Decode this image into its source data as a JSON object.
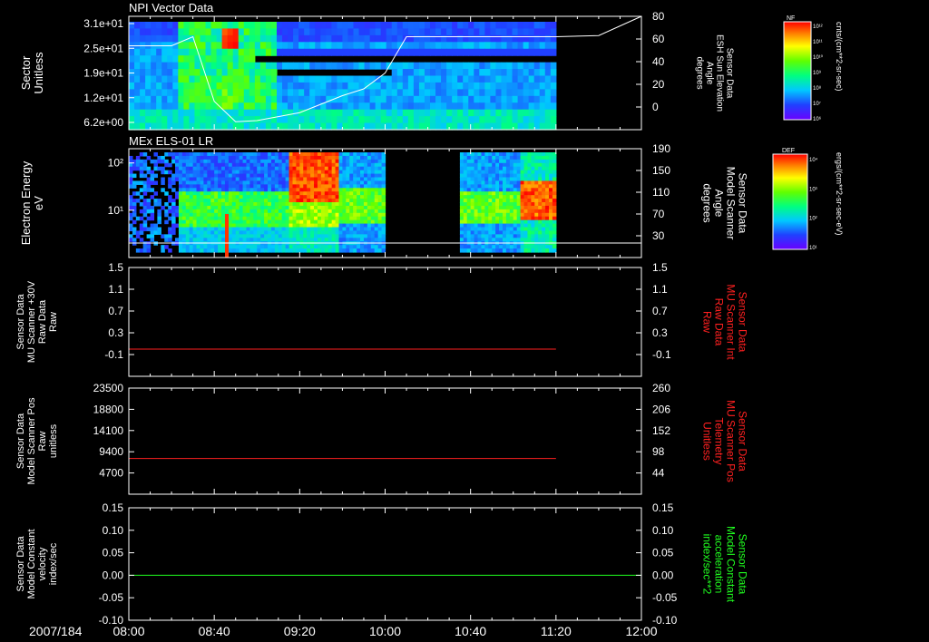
{
  "chart_data": [
    {
      "type": "heatmap",
      "title": "NPI Vector Data",
      "ylabel_left": [
        "Sector",
        "Unitless"
      ],
      "yticks_left": [
        "3.1e+01",
        "2.5e+01",
        "1.9e+01",
        "1.2e+01",
        "6.2e+00"
      ],
      "ylabel_right": [
        "Sensor Data",
        "ESH Sun Elevation",
        "Angle",
        "degrees"
      ],
      "yticks_right": [
        "80",
        "60",
        "40",
        "20",
        "0"
      ],
      "ylim_right": [
        -20,
        80
      ],
      "colorbar": {
        "label": "NF",
        "units": "cnts/(cm**2-sr-sec)",
        "ticks": [
          "10¹²",
          "10¹¹",
          "10¹⁰",
          "10⁹",
          "10⁸",
          "10⁷",
          "10⁶"
        ]
      },
      "data_end_time": "11:20",
      "overlay_line": {
        "color": "#ffffff",
        "x": [
          "08:00",
          "08:20",
          "08:30",
          "08:40",
          "08:50",
          "09:00",
          "09:20",
          "09:40",
          "09:50",
          "10:00",
          "10:10",
          "10:20",
          "10:40",
          "11:00",
          "11:20",
          "11:40",
          "12:00"
        ],
        "y": [
          54,
          54,
          62,
          5,
          -13,
          -12,
          -5,
          10,
          16,
          30,
          62,
          62,
          62,
          62,
          62,
          63,
          80
        ]
      }
    },
    {
      "type": "heatmap",
      "title": "MEx ELS-01 LR",
      "ylabel_left": [
        "Electron Energy",
        "eV"
      ],
      "yticks_left": [
        "10²",
        "10¹"
      ],
      "ylim_left_log": [
        1,
        200
      ],
      "ylabel_right": [
        "Sensor Data",
        "Model Scanner",
        "Angle",
        "degrees"
      ],
      "yticks_right": [
        "190",
        "150",
        "110",
        "70",
        "30"
      ],
      "ylim_right": [
        -10,
        190
      ],
      "colorbar": {
        "label": "DEF",
        "units": "ergs/(cm**2-sr-sec-eV)",
        "ticks": [
          "10⁴",
          "10³",
          "10²",
          "10¹"
        ]
      },
      "data_gaps": [
        [
          "10:00",
          "10:35"
        ]
      ],
      "data_end_time": "11:20",
      "overlay_line": {
        "color": "#ffffff",
        "x": [
          "08:00",
          "12:00"
        ],
        "y": [
          0,
          0
        ]
      }
    },
    {
      "type": "line",
      "ylabel_left": [
        "Sensor Data",
        "MU Scanner +30V",
        "Raw Data",
        "Raw"
      ],
      "yticks_left": [
        "1.5",
        "1.1",
        "0.7",
        "0.3",
        "-0.1"
      ],
      "ylim_left": [
        -0.5,
        1.5
      ],
      "ylabel_right": [
        "Sensor Data",
        "MU Scanner Int",
        "Raw Data",
        "Raw"
      ],
      "yticks_right": [
        "1.5",
        "1.1",
        "0.7",
        "0.3",
        "-0.1"
      ],
      "ylim_right": [
        -0.5,
        1.5
      ],
      "series": [
        {
          "color": "#ff2020",
          "x": [
            "08:00",
            "11:20"
          ],
          "y": [
            0,
            0
          ]
        }
      ]
    },
    {
      "type": "line",
      "ylabel_left": [
        "Sensor Data",
        "Model Scanner Pos",
        "Raw",
        "unitless"
      ],
      "yticks_left": [
        "23500",
        "18800",
        "14100",
        "9400",
        "4700"
      ],
      "ylim_left": [
        0,
        23500
      ],
      "ylabel_right": [
        "Sensor Data",
        "MU Scanner Pos",
        "Telemetry",
        "Unitless"
      ],
      "yticks_right": [
        "260",
        "206",
        "152",
        "98",
        "44"
      ],
      "ylim_right": [
        -10,
        260
      ],
      "series": [
        {
          "color": "#ff2020",
          "x": [
            "08:00",
            "11:20"
          ],
          "y": [
            7900,
            7900
          ]
        }
      ]
    },
    {
      "type": "line",
      "ylabel_left": [
        "Sensor Data",
        "Model Constant",
        "velocity",
        "index/sec"
      ],
      "yticks_left": [
        "0.15",
        "0.10",
        "0.05",
        "0.00",
        "-0.05",
        "-0.10"
      ],
      "ylim_left": [
        -0.1,
        0.15
      ],
      "ylabel_right": [
        "Sensor Data",
        "Model Constant",
        "acceleration",
        "index/sec**2"
      ],
      "yticks_right": [
        "0.15",
        "0.10",
        "0.05",
        "0.00",
        "-0.05",
        "-0.10"
      ],
      "ylim_right": [
        -0.1,
        0.15
      ],
      "series": [
        {
          "color": "#20ff20",
          "x": [
            "08:00",
            "12:00"
          ],
          "y": [
            0,
            0
          ]
        }
      ]
    }
  ],
  "time_axis": {
    "date_label": "2007/184",
    "tick_labels": [
      "08:00",
      "08:40",
      "09:20",
      "10:00",
      "10:40",
      "11:20",
      "12:00"
    ],
    "range": [
      "08:00",
      "12:00"
    ]
  },
  "colors": {
    "background": "#000000",
    "axes": "#ffffff",
    "red_label": "#ff2020",
    "green_label": "#20ff20"
  }
}
